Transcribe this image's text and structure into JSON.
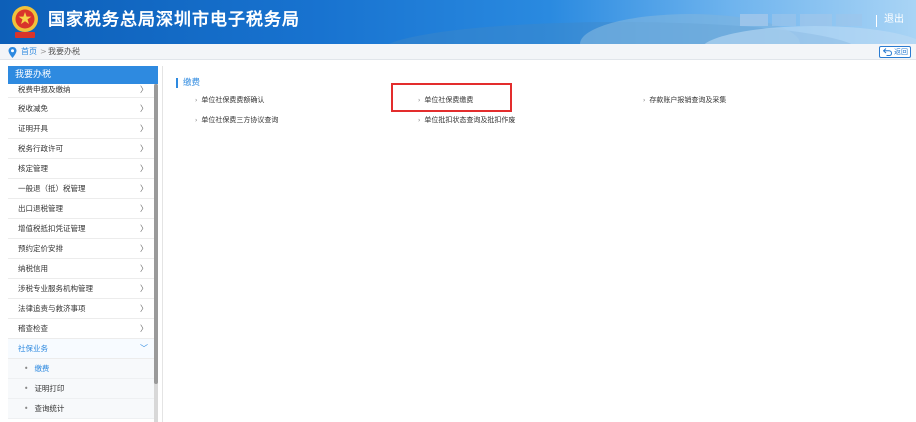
{
  "header": {
    "title": "国家税务总局深圳市电子税务局",
    "logout_label": "退出",
    "emblem_icon": "tax-emblem-icon"
  },
  "breadcrumb": {
    "home": "首页",
    "current": "我要办税",
    "back_label": "返回"
  },
  "sidebar": {
    "heading": "我要办税",
    "items": [
      {
        "label": "税费申报及缴纳"
      },
      {
        "label": "税收减免"
      },
      {
        "label": "证明开具"
      },
      {
        "label": "税务行政许可"
      },
      {
        "label": "核定管理"
      },
      {
        "label": "一般退（抵）税管理"
      },
      {
        "label": "出口退税管理"
      },
      {
        "label": "增值税抵扣凭证管理"
      },
      {
        "label": "预约定价安排"
      },
      {
        "label": "纳税信用"
      },
      {
        "label": "涉税专业服务机构管理"
      },
      {
        "label": "法律追责与救济事项"
      },
      {
        "label": "稽查检查"
      },
      {
        "label": "社保业务"
      }
    ],
    "sub_items": [
      {
        "label": "缴费"
      },
      {
        "label": "证明打印"
      },
      {
        "label": "查询统计"
      }
    ]
  },
  "main": {
    "section_title": "缴费",
    "links": [
      {
        "label": "单位社保费费额确认"
      },
      {
        "label": "单位社保费缴费"
      },
      {
        "label": "存款账户报销查询及采集"
      },
      {
        "label": "单位社保费三方协议查询"
      },
      {
        "label": "单位批扣状态查询及批扣作废"
      }
    ]
  },
  "colors": {
    "accent": "#2e8ae0",
    "highlight": "#e32d2d",
    "header_dark": "#0d5fb8"
  }
}
